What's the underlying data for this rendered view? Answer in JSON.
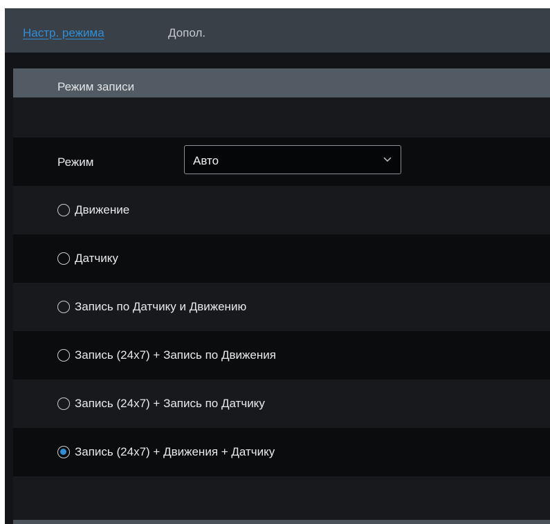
{
  "tabs": {
    "active": "Настр. режима",
    "other": "Допол."
  },
  "section": {
    "title": "Режим записи"
  },
  "mode": {
    "label": "Режим",
    "selected": "Авто"
  },
  "options": [
    {
      "label": "Движение",
      "checked": false
    },
    {
      "label": "Датчику",
      "checked": false
    },
    {
      "label": "Запись по Датчику и Движению",
      "checked": false
    },
    {
      "label": "Запись (24x7) + Запись по Движения",
      "checked": false
    },
    {
      "label": "Запись (24x7) + Запись по Датчику",
      "checked": false
    },
    {
      "label": "Запись (24x7) + Движения + Датчику",
      "checked": true
    }
  ],
  "colors": {
    "accent": "#2e8fd8",
    "tabbar": "#3a4047",
    "section_header": "#525a63",
    "background": "#121417"
  },
  "icons": {
    "select_arrow": "chevron-down-icon",
    "radio_off": "radio-unchecked-icon",
    "radio_on": "radio-checked-icon"
  }
}
